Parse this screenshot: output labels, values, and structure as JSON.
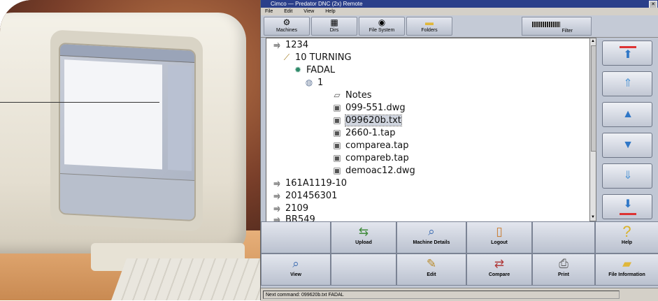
{
  "window": {
    "title": "Cimco — Predator DNC (2x) Remote",
    "menu": [
      "File",
      "Edit",
      "View",
      "Help"
    ]
  },
  "toolbar": {
    "machines": "Machines",
    "dirs": "Dirs",
    "file_system": "File System",
    "folders": "Folders",
    "filter": "Filter"
  },
  "tree": [
    {
      "label": "1234",
      "icon": "arrow-icon"
    },
    {
      "label": "10 TURNING",
      "icon": "drill-icon"
    },
    {
      "label": "FADAL",
      "icon": "gear-icon"
    },
    {
      "label": "1",
      "icon": "folder-icon"
    },
    {
      "label": "Notes",
      "icon": "note-icon"
    },
    {
      "label": "099-551.dwg",
      "icon": "document-icon"
    },
    {
      "label": "099620b.txt",
      "icon": "document-icon",
      "selected": true
    },
    {
      "label": "2660-1.tap",
      "icon": "document-icon"
    },
    {
      "label": "comparea.tap",
      "icon": "document-icon"
    },
    {
      "label": "compareb.tap",
      "icon": "document-icon"
    },
    {
      "label": "demoac12.dwg",
      "icon": "document-icon"
    },
    {
      "label": "161A1119-10",
      "icon": "arrow-icon"
    },
    {
      "label": "201456301",
      "icon": "arrow-icon"
    },
    {
      "label": "2109",
      "icon": "arrow-icon"
    },
    {
      "label": "BR549",
      "icon": "arrow-icon"
    }
  ],
  "actions": {
    "upload": "Upload",
    "machine_details": "Machine Details",
    "logout": "Logout",
    "help": "Help",
    "view": "View",
    "edit": "Edit",
    "compare": "Compare",
    "print": "Print",
    "file_information": "File Information"
  },
  "status": {
    "text": "Next command: 099620b.txt FADAL"
  },
  "colors": {
    "accent": "#2f77c7",
    "selection": "#cfd4de",
    "title_bar": "#2a3f8a"
  }
}
